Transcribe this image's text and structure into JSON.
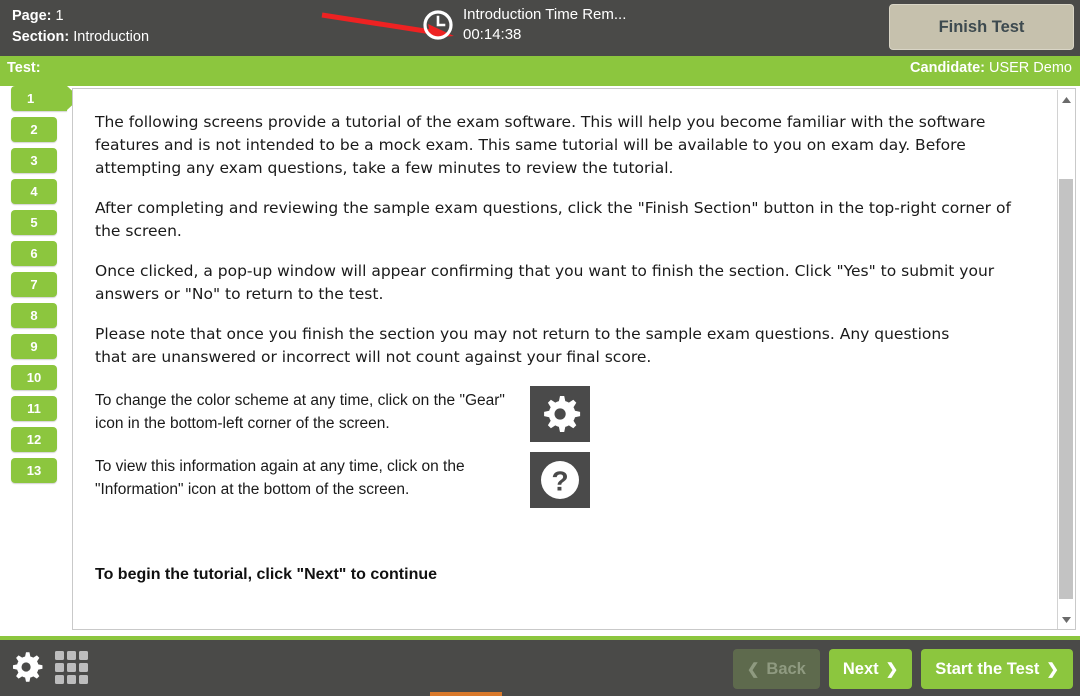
{
  "header": {
    "page_label": "Page:",
    "page_value": "1",
    "section_label": "Section:",
    "section_value": "Introduction",
    "timer_label": "Introduction Time Rem...",
    "timer_value": "00:14:38",
    "finish_test_label": "Finish Test",
    "clock_icon": "clock-icon",
    "annotation_arrow": "red-arrow-annotation"
  },
  "subbar": {
    "test_label": "Test:",
    "test_value": "",
    "candidate_label": "Candidate:",
    "candidate_value": " USER Demo"
  },
  "pager": {
    "active_index": 0,
    "buttons": [
      "1",
      "2",
      "3",
      "4",
      "5",
      "6",
      "7",
      "8",
      "9",
      "10",
      "11",
      "12",
      "13"
    ]
  },
  "content": {
    "paragraphs": [
      "The following screens provide a tutorial of the exam software. This will help you become familiar with the software features and is not intended to be a mock exam. This same tutorial will be available to you on exam day. Before attempting any exam questions, take a few minutes to review the tutorial.",
      "After completing and reviewing the sample exam questions, click the \"Finish Section\" button in the top-right corner of the screen.",
      "Once clicked, a pop-up window will appear confirming that you want to finish the section. Click \"Yes\" to submit your answers or \"No\" to return to the test.",
      "Please note that once you finish the section you may not return to the sample exam questions. Any questions that are unanswered or incorrect will not count against your final score."
    ],
    "icon_rows": [
      {
        "text": "To change the color scheme at any time, click on the \"Gear\" icon in the bottom-left corner of the screen.",
        "icon": "gear-icon"
      },
      {
        "text": "To view this information again at any time, click on the \"Information\" icon at the bottom of the screen.",
        "icon": "question-mark-icon"
      }
    ],
    "begin_line": "To begin the tutorial, click \"Next\" to continue"
  },
  "scrollbar": {
    "up_arrow": "scroll-up-arrow",
    "down_arrow": "scroll-down-arrow",
    "thumb": "scroll-thumb"
  },
  "footer": {
    "settings_icon": "gear-icon",
    "grid_icon": "grid-icon",
    "back_label": "Back",
    "back_chevron": "❮",
    "next_label": "Next",
    "next_chevron": "❯",
    "start_label": "Start the Test",
    "start_chevron": "❯",
    "back_disabled": true
  },
  "colors": {
    "green": "#8cc63e",
    "dark": "#4a4a48",
    "beige": "#c6c1ad",
    "annotation_red": "#ee2222",
    "orange_sliver": "#d9792a"
  }
}
